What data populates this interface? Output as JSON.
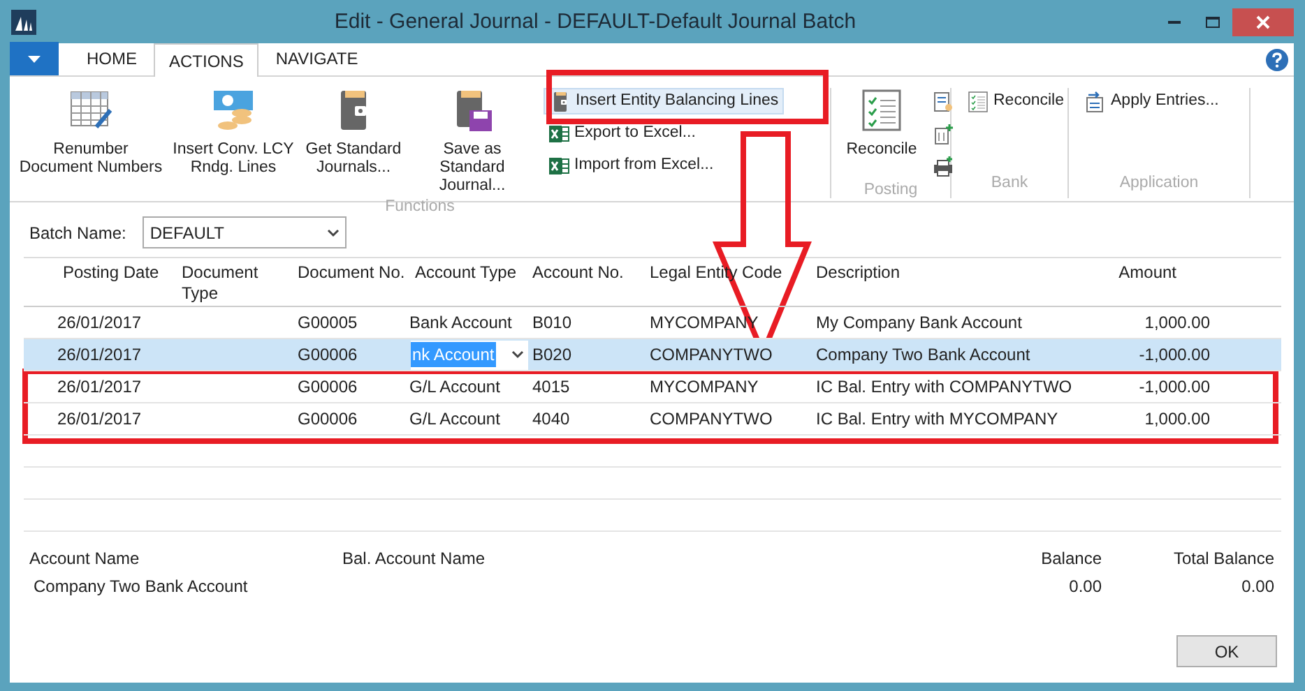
{
  "window": {
    "title": "Edit - General Journal - DEFAULT-Default Journal Batch"
  },
  "tabs": [
    {
      "label": "HOME",
      "selected": false
    },
    {
      "label": "ACTIONS",
      "selected": true
    },
    {
      "label": "NAVIGATE",
      "selected": false
    }
  ],
  "ribbon": {
    "groups": [
      {
        "label": "Functions",
        "large": [
          "Renumber Document Numbers",
          "Insert Conv. LCY Rndg. Lines",
          "Get Standard Journals...",
          "Save as Standard Journal..."
        ],
        "small": [
          {
            "label": "Insert Entity Balancing Lines",
            "selected": true
          },
          {
            "label": "Export to Excel...",
            "selected": false
          },
          {
            "label": "Import from Excel...",
            "selected": false
          }
        ]
      },
      {
        "label": "Posting",
        "large": [
          "Reconcile"
        ]
      },
      {
        "label": "Bank",
        "small": [
          {
            "label": "Reconcile",
            "selected": false
          }
        ]
      },
      {
        "label": "Application",
        "small": [
          {
            "label": "Apply Entries...",
            "selected": false
          }
        ]
      }
    ]
  },
  "batch": {
    "label": "Batch Name:",
    "value": "DEFAULT"
  },
  "table": {
    "columns": [
      "Posting Date",
      "Document Type",
      "Document No.",
      "Account Type",
      "Account No.",
      "Legal Entity Code",
      "Description",
      "Amount"
    ],
    "rows": [
      {
        "selected": false,
        "cells": [
          "26/01/2017",
          "",
          "G00005",
          "Bank Account",
          "B010",
          "MYCOMPANY",
          "My Company Bank Account",
          "1,000.00"
        ]
      },
      {
        "selected": true,
        "cells": [
          "26/01/2017",
          "",
          "G00006",
          "nk Account",
          "B020",
          "COMPANYTWO",
          "Company Two Bank Account",
          "-1,000.00"
        ]
      },
      {
        "selected": false,
        "cells": [
          "26/01/2017",
          "",
          "G00006",
          "G/L Account",
          "4015",
          "MYCOMPANY",
          "IC Bal. Entry with COMPANYTWO",
          "-1,000.00"
        ]
      },
      {
        "selected": false,
        "cells": [
          "26/01/2017",
          "",
          "G00006",
          "G/L Account",
          "4040",
          "COMPANYTWO",
          "IC Bal. Entry with MYCOMPANY",
          "1,000.00"
        ]
      }
    ]
  },
  "footer": [
    {
      "label": "Account Name",
      "value": "Company Two Bank Account"
    },
    {
      "label": "Bal. Account Name"
    },
    {
      "label": "Balance",
      "value": "0.00"
    },
    {
      "label": "Total Balance",
      "value": "0.00"
    }
  ],
  "ok_button": "OK",
  "annotations": [
    {
      "kind": "frame"
    },
    {
      "kind": "arrow"
    },
    {
      "kind": "frame"
    }
  ]
}
